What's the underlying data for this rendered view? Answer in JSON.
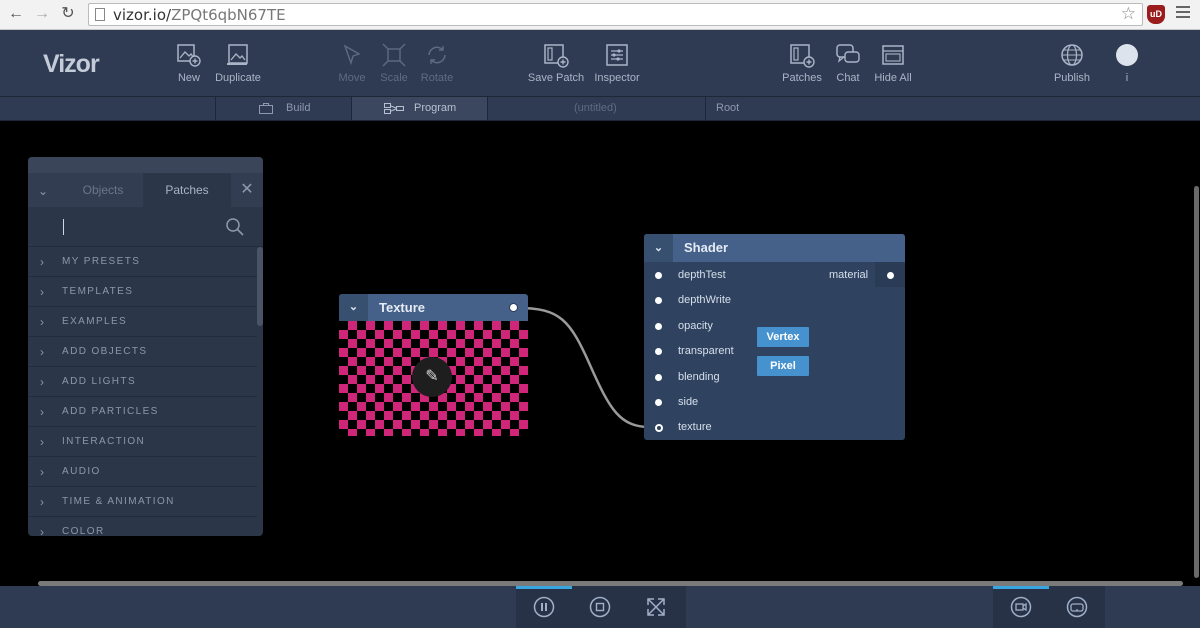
{
  "browser": {
    "url_host": "vizor.io/",
    "url_path": "ZPQt6qbN67TE",
    "extension_label": "uD"
  },
  "app": {
    "logo": "Vizor"
  },
  "toolbar": {
    "new": "New",
    "duplicate": "Duplicate",
    "move": "Move",
    "scale": "Scale",
    "rotate": "Rotate",
    "save_patch": "Save Patch",
    "inspector": "Inspector",
    "patches": "Patches",
    "chat": "Chat",
    "hide_all": "Hide All",
    "publish": "Publish",
    "user": "i"
  },
  "subbar": {
    "build": "Build",
    "program": "Program",
    "document": "(untitled)",
    "breadcrumb": "Root"
  },
  "library": {
    "tabs": [
      "Objects",
      "Patches"
    ],
    "active_tab": "Patches",
    "search_placeholder": "",
    "items": [
      "MY PRESETS",
      "TEMPLATES",
      "EXAMPLES",
      "ADD OBJECTS",
      "ADD LIGHTS",
      "ADD PARTICLES",
      "INTERACTION",
      "AUDIO",
      "TIME & ANIMATION",
      "COLOR"
    ]
  },
  "texture_node": {
    "title": "Texture"
  },
  "shader_node": {
    "title": "Shader",
    "inputs": [
      "depthTest",
      "depthWrite",
      "opacity",
      "transparent",
      "blending",
      "side",
      "texture"
    ],
    "output": "material",
    "buttons": [
      "Vertex",
      "Pixel"
    ]
  },
  "colors": {
    "toolbar_bg": "#2f3b52",
    "node_header": "#456089",
    "node_body": "#2f4361",
    "accent": "#3aa6e0",
    "checker_pink": "#d0267a"
  }
}
